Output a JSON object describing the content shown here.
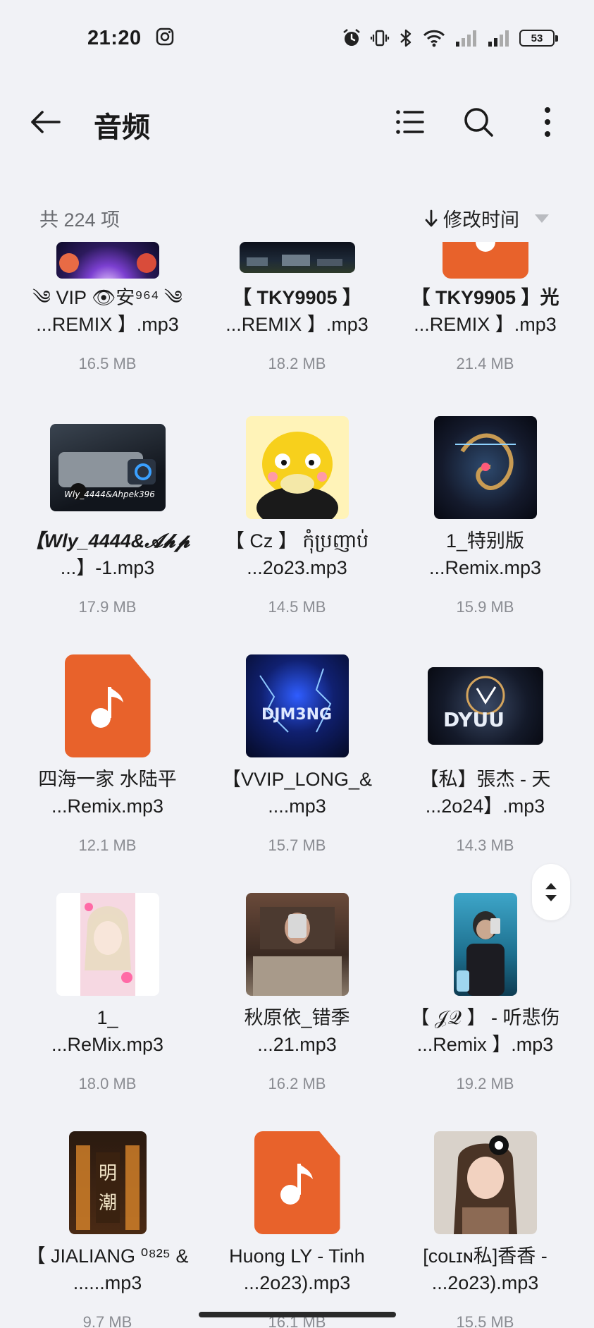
{
  "status_bar": {
    "time": "21:20",
    "battery": "53",
    "icons": [
      "instagram-icon",
      "alarm-icon",
      "vibrate-icon",
      "bluetooth-icon",
      "wifi-icon",
      "signal-icon",
      "signal-icon-2"
    ]
  },
  "header": {
    "title": "音频"
  },
  "toolbar": {
    "count_label": "共 224 项",
    "sort_label": "修改时间"
  },
  "colors": {
    "accent_orange": "#e8622b",
    "background": "#f1f2f6"
  },
  "files": [
    {
      "line1": "༄ VIP 👁安⁹⁶⁴ ༄",
      "line2": "...REMIX 】.mp3",
      "size": "16.5 MB"
    },
    {
      "line1": "【 TKY9905 】",
      "line2": "...REMIX 】.mp3",
      "size": "18.2 MB"
    },
    {
      "line1": "【 TKY9905 】光",
      "line2": "...REMIX 】.mp3",
      "size": "21.4 MB"
    },
    {
      "line1": "【Wly_4444&𝓐𝓱𝓹",
      "line2": "...】-1.mp3",
      "size": "17.9 MB"
    },
    {
      "line1": "【 Cz 】 កុំប្រញាប់",
      "line2": "...2o23.mp3",
      "size": "14.5 MB"
    },
    {
      "line1": "1_特别版",
      "line2": "...Remix.mp3",
      "size": "15.9 MB"
    },
    {
      "line1": "四海一家 水陆平",
      "line2": "...Remix.mp3",
      "size": "12.1 MB"
    },
    {
      "line1": "【VVIP_LONG_&",
      "line2": "....mp3",
      "size": "15.7 MB"
    },
    {
      "line1": "【私】張杰 - 天",
      "line2": "...2o24】.mp3",
      "size": "14.3 MB"
    },
    {
      "line1": "1_",
      "line2": "...ReMix.mp3",
      "size": "18.0 MB"
    },
    {
      "line1": "秋原依_错季",
      "line2": "...21.mp3",
      "size": "16.2 MB"
    },
    {
      "line1": "【 𝒥𝒬 】 - 听悲伤",
      "line2": "...Remix 】.mp3",
      "size": "19.2 MB"
    },
    {
      "line1": "【 JIALIANG ⁰⁸²⁵ &",
      "line2": "......mp3",
      "size": "9.7 MB"
    },
    {
      "line1": "Huong LY - Tinh",
      "line2": "...2o23).mp3",
      "size": "16.1 MB"
    },
    {
      "line1": "[ᴄᴏʟɪɴ私]香香 -",
      "line2": "...2o23).mp3",
      "size": "15.5 MB"
    }
  ]
}
